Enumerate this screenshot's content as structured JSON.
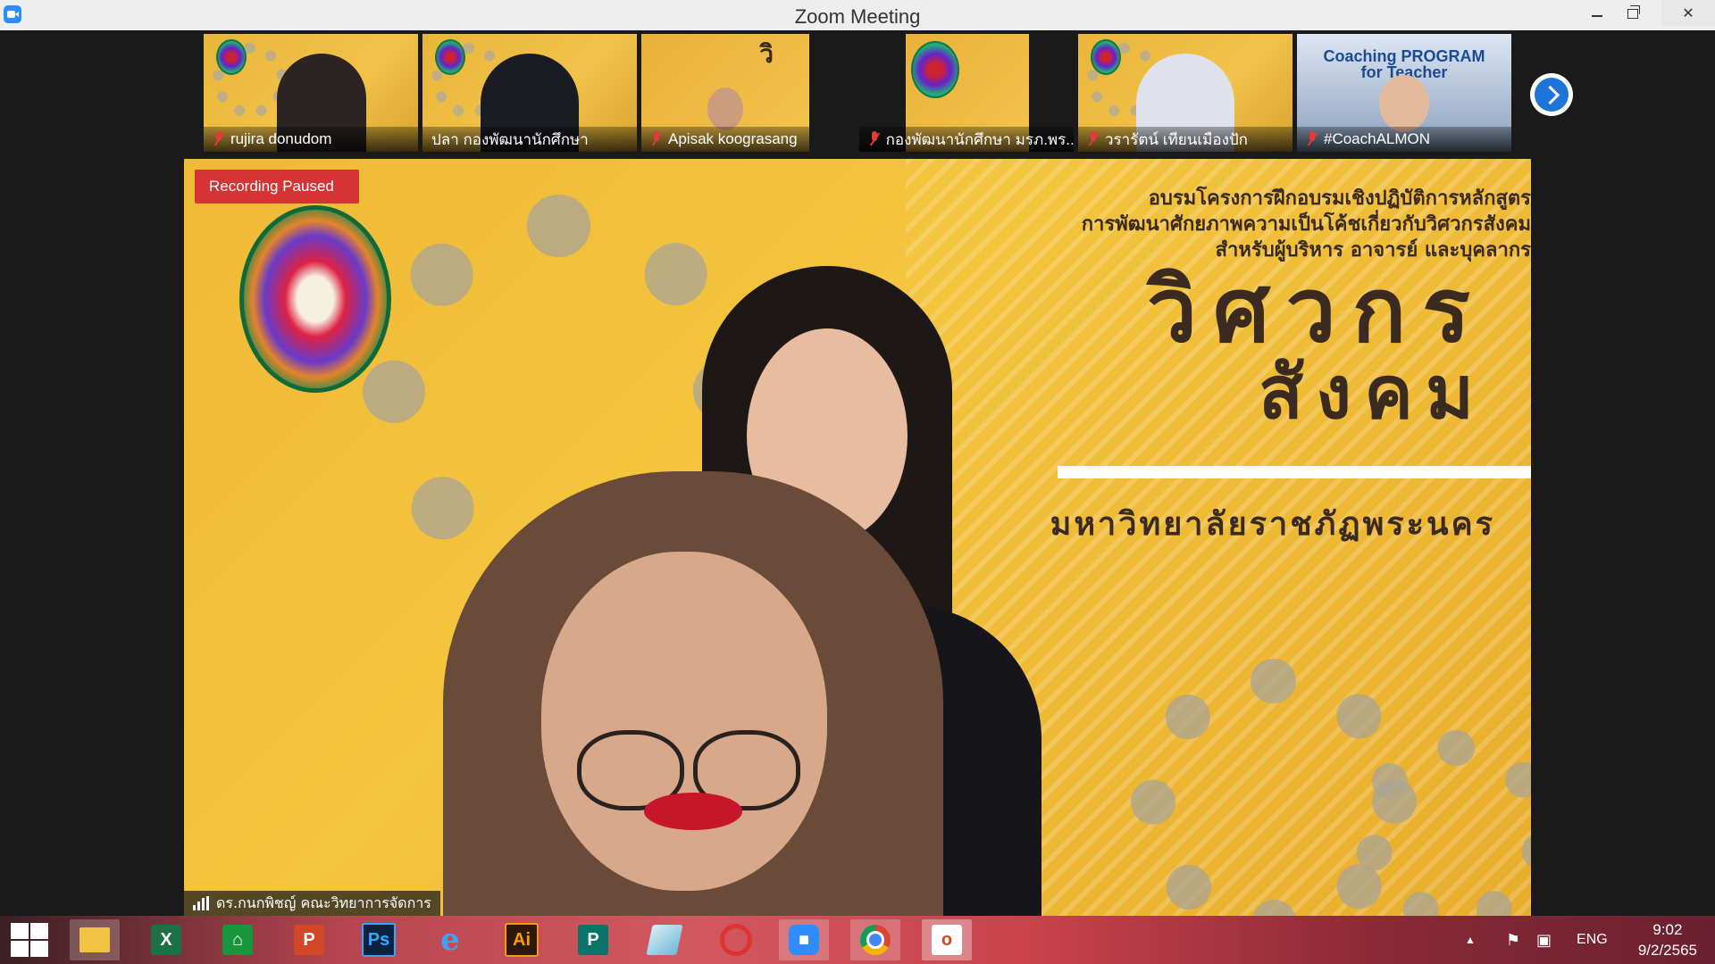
{
  "window": {
    "title": "Zoom Meeting"
  },
  "participants": [
    {
      "name": "rujira donudom",
      "muted": true
    },
    {
      "name": "ปลา กองพัฒนานักศึกษา",
      "muted": false
    },
    {
      "name": "Apisak koograsang",
      "muted": true
    },
    {
      "name": "กองพัฒนานักศึกษา มรภ.พร...",
      "muted": true
    },
    {
      "name": "วรารัตน์ เทียนเมืองปัก",
      "muted": true
    },
    {
      "name": "#CoachALMON",
      "muted": true
    }
  ],
  "thumb_text": {
    "vi": "วิ",
    "sot": "ศวกร\nสังคม",
    "coach": "Coaching PROGRAM\nfor Teacher"
  },
  "main": {
    "recording_status": "Recording Paused",
    "speaker_name": "ดร.กนกพิชญ์ คณะวิทยาการจัดการ",
    "banner_subtitle": "อบรมโครงการฝึกอบรมเชิงปฏิบัติการหลักสูตร\nการพัฒนาศักยภาพความเป็นโค้ชเกี่ยวกับวิศวกรสังคม\nสำหรับผู้บริหาร อาจารย์ และบุคลากร",
    "banner_title_line1": "วิศวกร",
    "banner_title_line2": "สังคม",
    "banner_university": "มหาวิทยาลัยราชภัฏพระนคร"
  },
  "taskbar": {
    "apps": [
      "start-icon",
      "file-explorer-icon",
      "excel-icon",
      "store-icon",
      "powerpoint-icon",
      "photoshop-icon",
      "internet-explorer-icon",
      "illustrator-icon",
      "publisher-icon",
      "app-icon",
      "photoscape-icon",
      "zoom-icon",
      "chrome-icon",
      "office-icon"
    ],
    "app_labels": {
      "excel": "X",
      "powerpoint": "P",
      "photoshop": "Ps",
      "illustrator": "Ai",
      "publisher": "P"
    },
    "language": "ENG",
    "time": "9:02",
    "date": "9/2/2565"
  },
  "colors": {
    "accent": "#2d8cff",
    "recording": "#d63434",
    "banner_yellow": "#f0b936"
  }
}
